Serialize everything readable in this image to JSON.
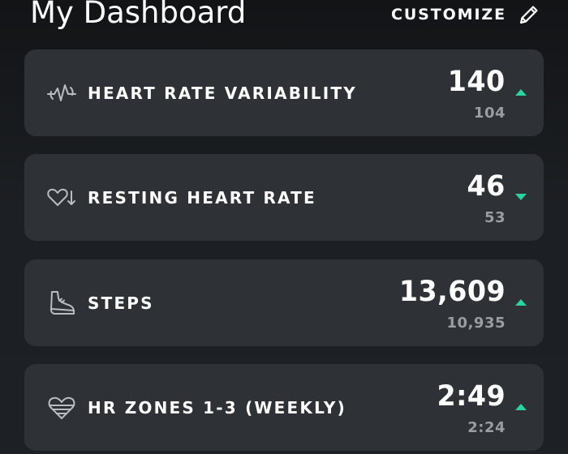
{
  "header": {
    "title": "My Dashboard",
    "customize_label": "CUSTOMIZE",
    "customize_icon": "pencil-icon"
  },
  "accent_color": "#28d4a0",
  "cards": [
    {
      "label": "HEART RATE VARIABILITY",
      "value": "140",
      "previous": "104",
      "trend": "up",
      "icon": "hrv-wave-icon"
    },
    {
      "label": "RESTING HEART RATE",
      "value": "46",
      "previous": "53",
      "trend": "down",
      "icon": "heart-down-arrow-icon"
    },
    {
      "label": "STEPS",
      "value": "13,609",
      "previous": "10,935",
      "trend": "up",
      "icon": "shoe-icon"
    },
    {
      "label": "HR ZONES 1-3 (WEEKLY)",
      "value": "2:49",
      "previous": "2:24",
      "trend": "up",
      "icon": "heart-zones-icon"
    }
  ]
}
